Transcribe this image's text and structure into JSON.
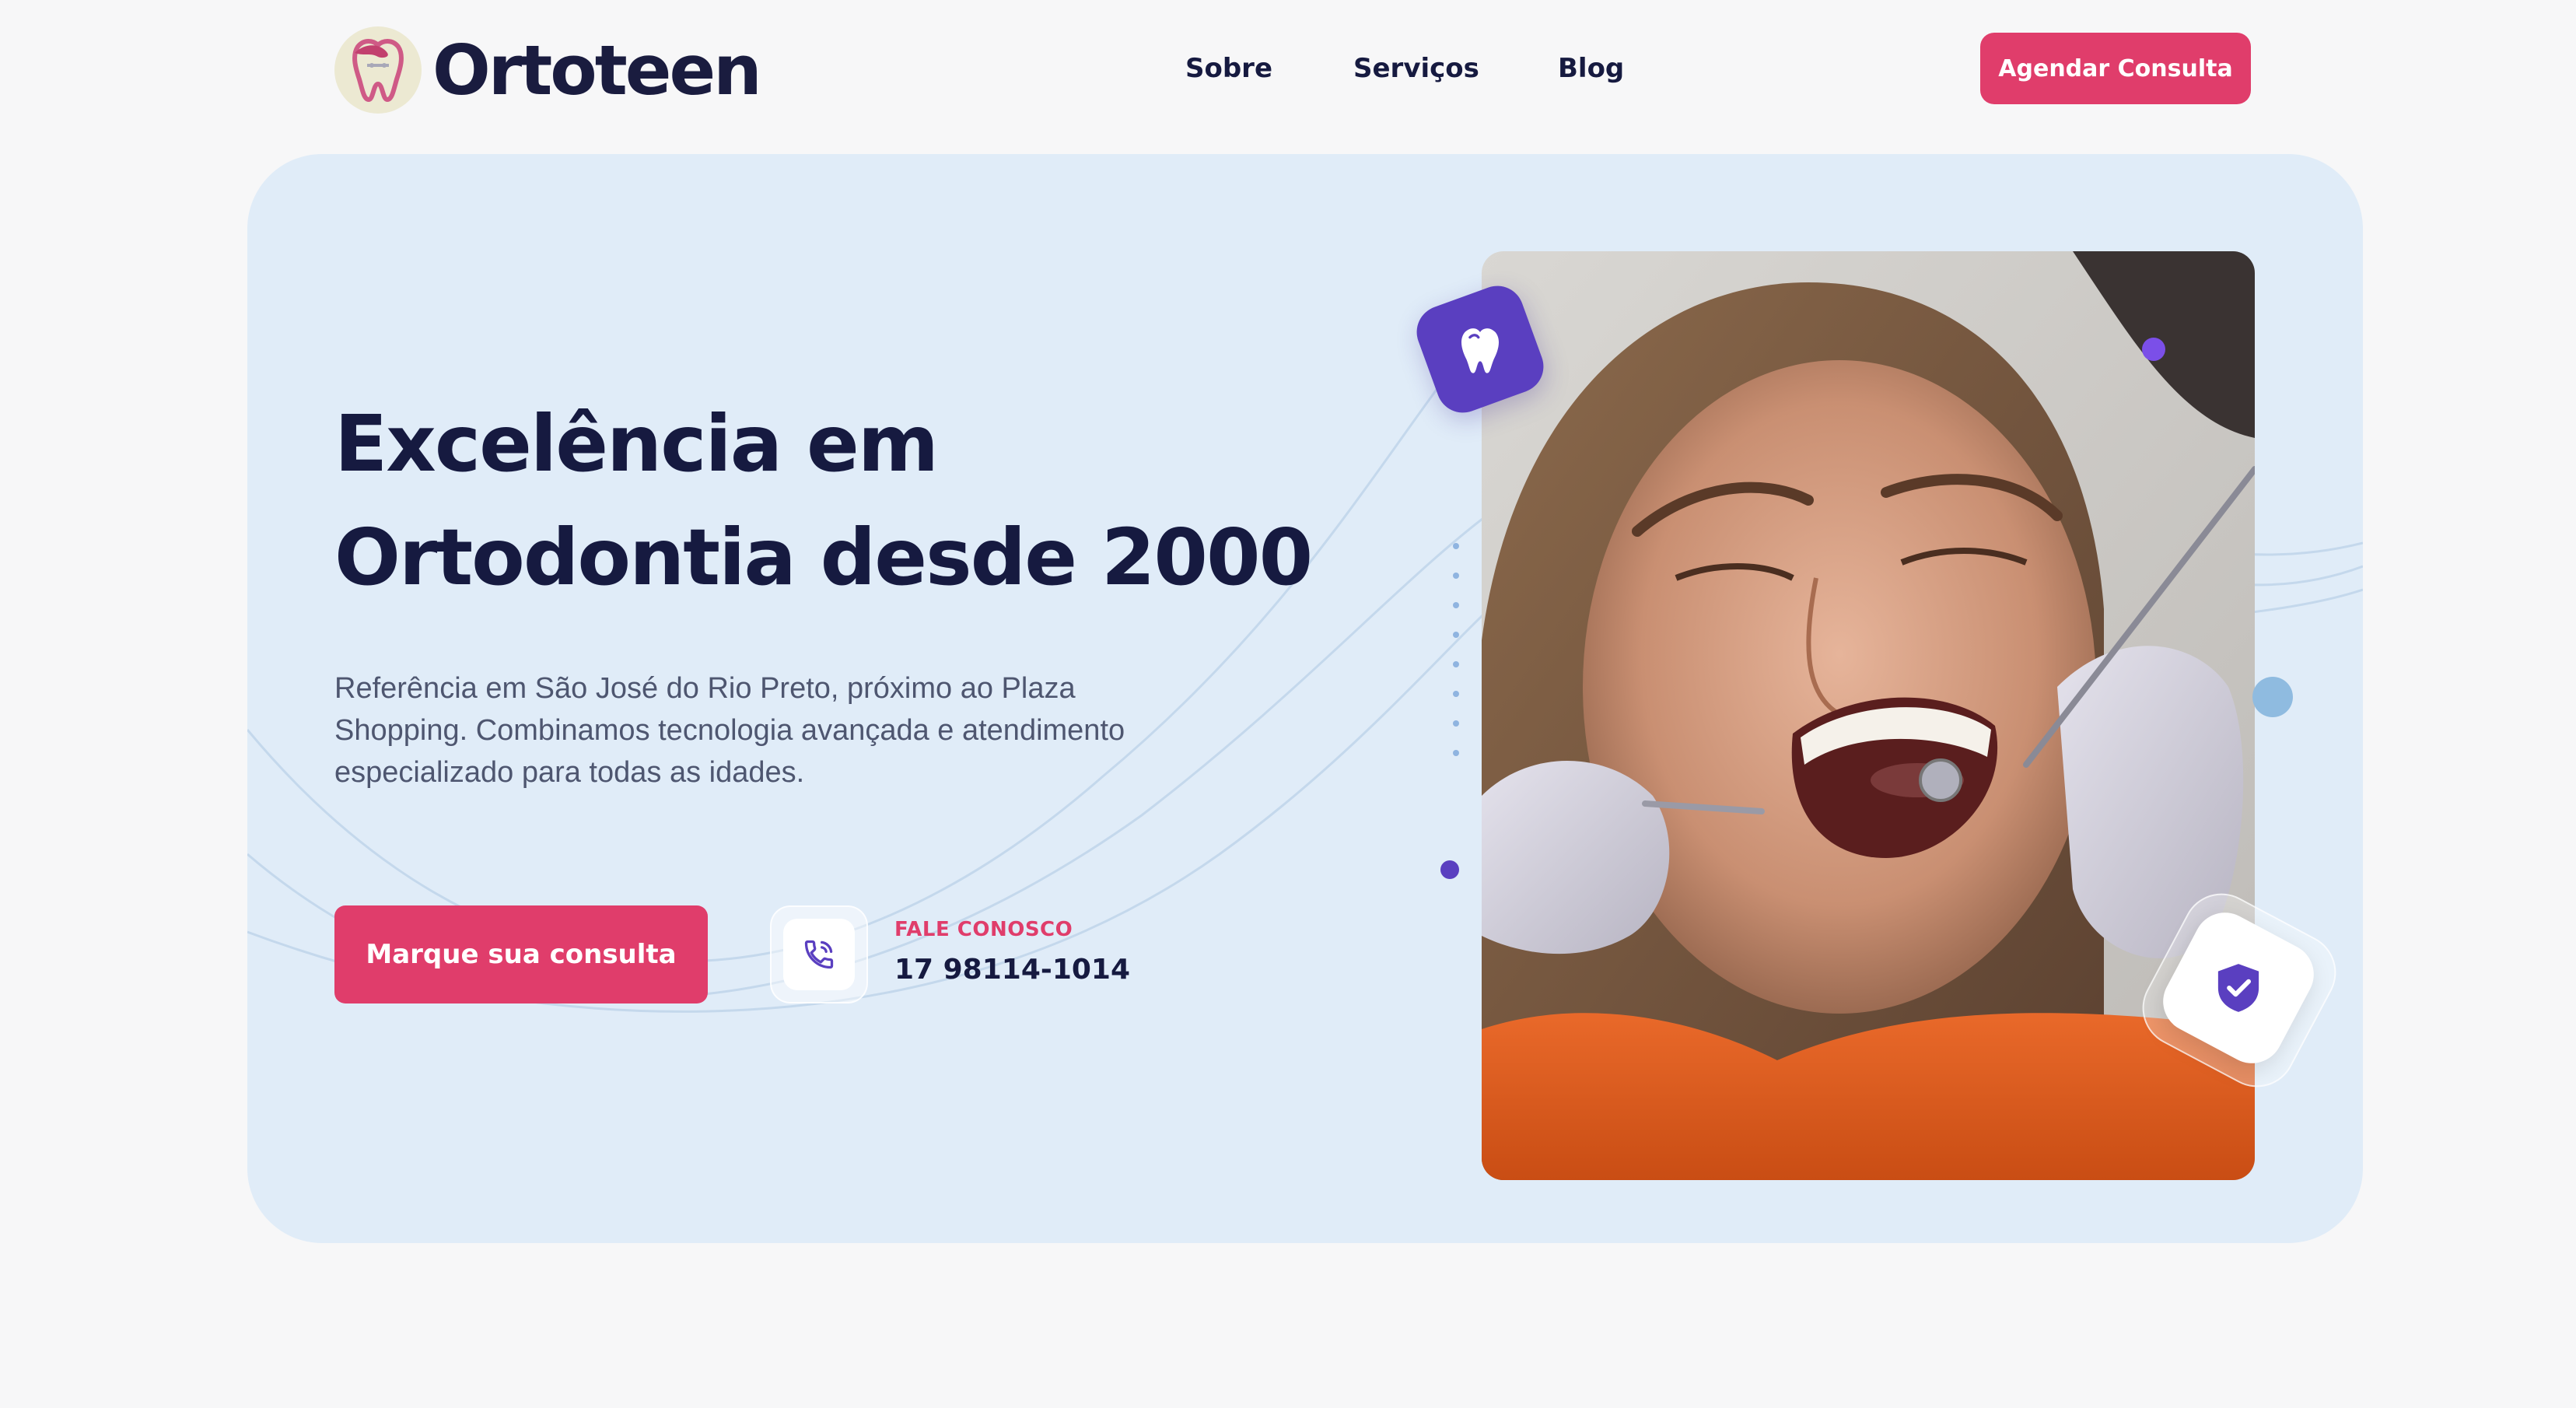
{
  "header": {
    "logo_text": "Ortoteen",
    "nav": [
      {
        "label": "Sobre"
      },
      {
        "label": "Serviços"
      },
      {
        "label": "Blog"
      }
    ],
    "cta_label": "Agendar Consulta"
  },
  "hero": {
    "headline_line1": "Excelência em",
    "headline_line2": "Ortodontia desde 2000",
    "subtext": "Referência em São José do Rio Preto, próximo ao Plaza Shopping. Combinamos tecnologia avançada e atendimento especializado para todas as idades.",
    "cta_label": "Marque sua consulta",
    "contact_label": "FALE CONOSCO",
    "contact_phone": "17 98114-1014"
  },
  "icons": {
    "phone": "phone-icon",
    "tooth": "tooth-icon",
    "shield": "shield-check-icon"
  },
  "colors": {
    "accent": "#e03d6b",
    "primary_dark": "#161a40",
    "purple": "#5a3fc0",
    "hero_bg": "#e0ecf8",
    "page_bg": "#f7f7f8"
  }
}
